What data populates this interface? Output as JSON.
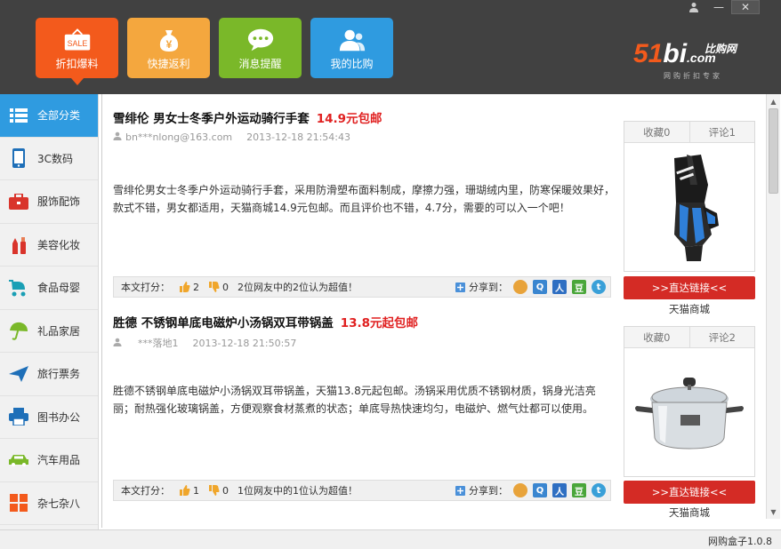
{
  "window": {
    "minimize": "—",
    "close": "✕"
  },
  "tabs": [
    {
      "label": "折扣爆料",
      "icon": "sale-tag-icon",
      "badge": "SALE",
      "color": "#f35a1c"
    },
    {
      "label": "快捷返利",
      "icon": "money-bag-icon",
      "badge": "¥",
      "color": "#f4a73e"
    },
    {
      "label": "消息提醒",
      "icon": "chat-bubble-icon",
      "color": "#7ab829"
    },
    {
      "label": "我的比购",
      "icon": "users-icon",
      "color": "#2f9be0"
    }
  ],
  "logo": {
    "num": "51",
    "bi": "bi",
    "dotcom": ".com",
    "cn": "比购网",
    "slogan": "网购折扣专家"
  },
  "sidebar": {
    "items": [
      {
        "label": "全部分类",
        "icon": "list-icon",
        "active": true
      },
      {
        "label": "3C数码",
        "icon": "phone-icon"
      },
      {
        "label": "服饰配饰",
        "icon": "bag-icon"
      },
      {
        "label": "美容化妆",
        "icon": "cosmetics-icon"
      },
      {
        "label": "食品母婴",
        "icon": "stroller-icon"
      },
      {
        "label": "礼品家居",
        "icon": "umbrella-icon"
      },
      {
        "label": "旅行票务",
        "icon": "plane-icon"
      },
      {
        "label": "图书办公",
        "icon": "printer-icon"
      },
      {
        "label": "汽车用品",
        "icon": "car-icon"
      },
      {
        "label": "杂七杂八",
        "icon": "grid-icon"
      }
    ]
  },
  "posts": [
    {
      "title": "雪绯伦 男女士冬季户外运动骑行手套",
      "price": "14.9元包邮",
      "user": "bn***nlong@163.com",
      "date": "2013-12-18 21:54:43",
      "desc": "雪绯伦男女士冬季户外运动骑行手套，采用防滑塑布面料制成，摩擦力强，珊瑚绒内里，防寒保暖效果好，款式不错，男女都适用，天猫商城14.9元包邮。而且评价也不错，4.7分，需要的可以入一个吧！",
      "rate_label": "本文打分：",
      "up": "2",
      "down": "0",
      "summary": "2位网友中的2位认为超值！",
      "share_label": "分享到：",
      "fav": "收藏0",
      "comments": "评论1",
      "btn": ">>直达链接<<",
      "shop": "天猫商城"
    },
    {
      "title": "胜德 不锈钢单底电磁炉小汤锅双耳带锅盖",
      "price": "13.8元起包邮",
      "user": "***落地1",
      "date": "2013-12-18 21:50:57",
      "desc": "胜德不锈钢单底电磁炉小汤锅双耳带锅盖，天猫13.8元起包邮。汤锅采用优质不锈钢材质，锅身光洁亮丽；耐热强化玻璃锅盖，方便观察食材蒸煮的状态；单底导热快速均匀，电磁炉、燃气灶都可以使用。",
      "rate_label": "本文打分：",
      "up": "1",
      "down": "0",
      "summary": "1位网友中的1位认为超值！",
      "share_label": "分享到：",
      "fav": "收藏0",
      "comments": "评论2",
      "btn": ">>直达链接<<",
      "shop": "天猫商城"
    }
  ],
  "share_icons": [
    "weibo-icon",
    "qzone-icon",
    "renren-icon",
    "douban-icon",
    "tqq-icon"
  ],
  "share_glyphs": [
    "",
    "Q",
    "人",
    "豆",
    "t"
  ],
  "status": {
    "version": "网购盒子1.0.8"
  }
}
